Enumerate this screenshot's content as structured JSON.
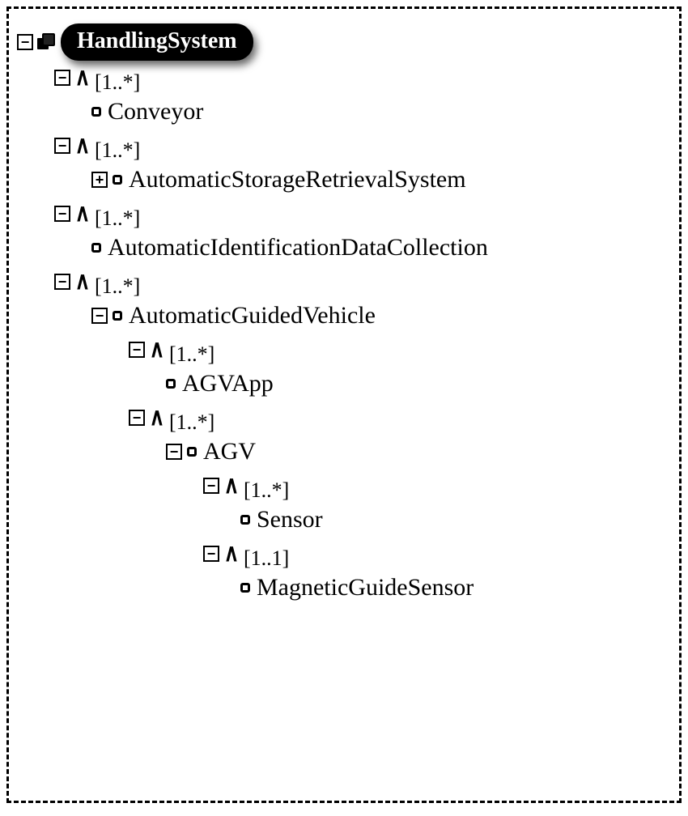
{
  "root": {
    "label": "HandlingSystem"
  },
  "card_1n": "[1..*]",
  "card_11": "[1..1]",
  "nodes": {
    "conveyor": "Conveyor",
    "asrs": "AutomaticStorageRetrievalSystem",
    "aidc": "AutomaticIdentificationDataCollection",
    "agv": "AutomaticGuidedVehicle",
    "agvapp": "AGVApp",
    "agv2": "AGV",
    "sensor": "Sensor",
    "mgs": "MagneticGuideSensor"
  }
}
